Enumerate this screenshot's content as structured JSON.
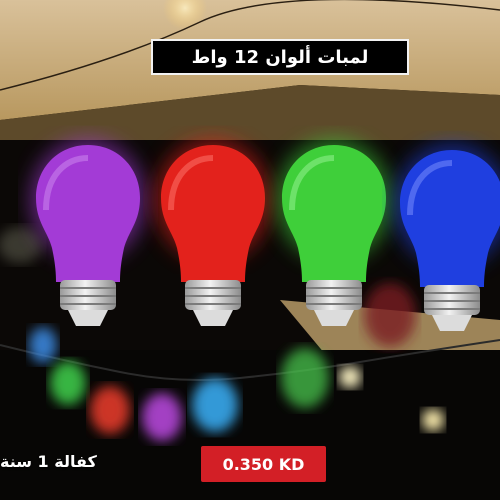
{
  "title": "لمبات ألوان 12 واط",
  "price": "0.350 KD",
  "warranty": "كفالة 1 سنة",
  "colors": {
    "purple": "#a33bd6",
    "red": "#e3221c",
    "green": "#3fcf3a",
    "blue": "#1f3fe0",
    "price_bg": "#d31f26"
  }
}
